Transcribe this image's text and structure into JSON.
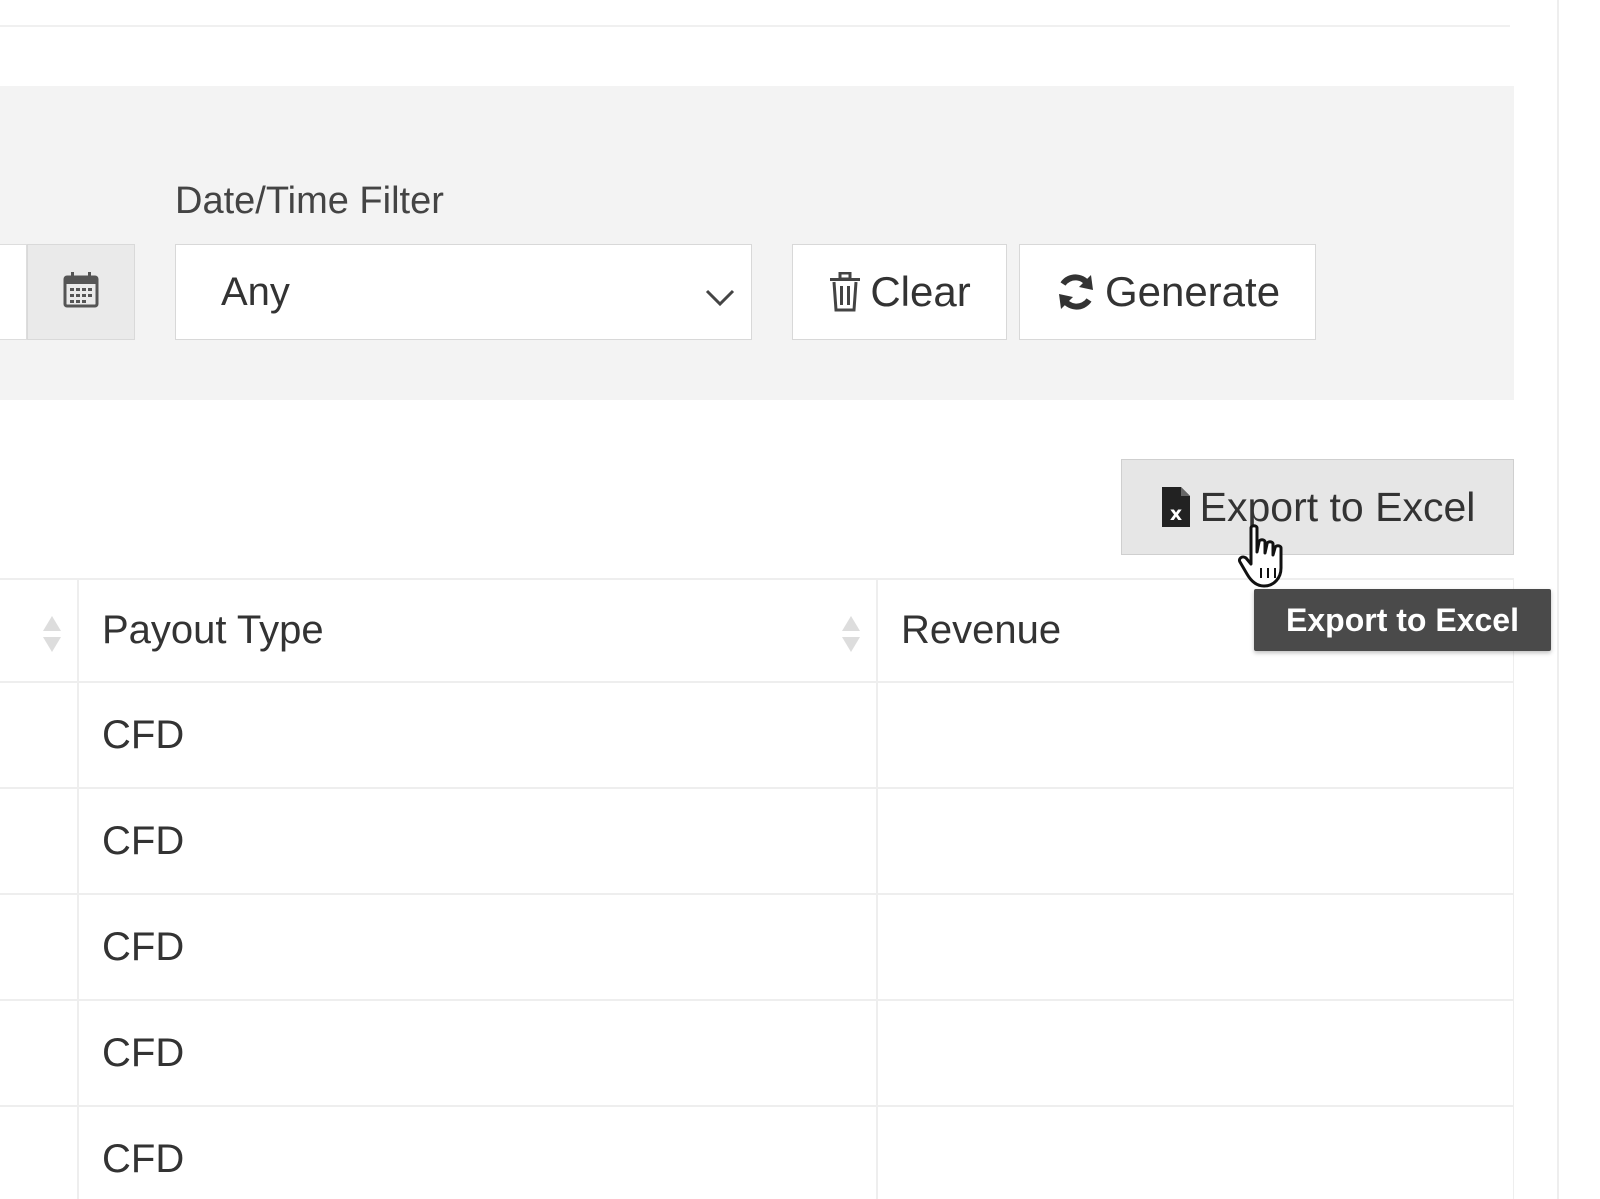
{
  "filters": {
    "datetime_label": "Date/Time Filter",
    "datetime_value": "Any"
  },
  "buttons": {
    "clear_label": "Clear",
    "generate_label": "Generate",
    "export_label": "Export to Excel"
  },
  "tooltip": {
    "text": "Export to Excel"
  },
  "table": {
    "columns": [
      "",
      "Payout Type",
      "Revenue"
    ],
    "rows": [
      [
        "",
        "CFD",
        ""
      ],
      [
        "",
        "CFD",
        ""
      ],
      [
        "",
        "CFD",
        ""
      ],
      [
        "",
        "CFD",
        ""
      ],
      [
        "",
        "CFD",
        ""
      ]
    ]
  },
  "icons": {
    "calendar": "calendar-icon",
    "chevron": "chevron-down-icon",
    "trash": "trash-icon",
    "refresh": "refresh-icon",
    "excel": "excel-file-icon",
    "sort": "sort-icon",
    "cursor": "hand-cursor-icon"
  },
  "colors": {
    "panel_bg": "#f3f3f3",
    "tooltip_bg": "#4a4a4a",
    "export_bg": "#e6e6e6"
  }
}
